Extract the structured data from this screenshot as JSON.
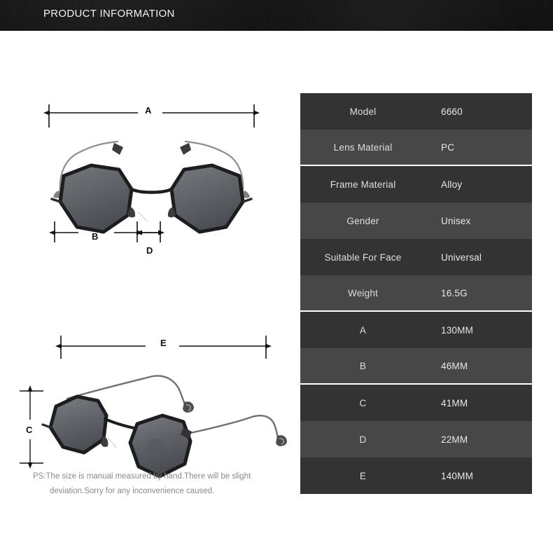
{
  "header": {
    "title": "PRODUCT INFORMATION"
  },
  "diagrams": {
    "front_view": {
      "name": "sunglasses-front-view",
      "dimension_labels": [
        "A",
        "B",
        "D"
      ]
    },
    "angled_view": {
      "name": "sunglasses-angled-view",
      "dimension_labels": [
        "E",
        "C"
      ]
    },
    "labels": {
      "a": "A",
      "b": "B",
      "c": "C",
      "d": "D",
      "e": "E"
    }
  },
  "spec_table": {
    "rows": [
      {
        "label": "Model",
        "value": "6660"
      },
      {
        "label": "Lens Material",
        "value": "PC"
      },
      {
        "label": "Frame Material",
        "value": "Alloy"
      },
      {
        "label": "Gender",
        "value": "Unisex"
      },
      {
        "label": "Suitable For Face",
        "value": "Universal"
      },
      {
        "label": "Weight",
        "value": "16.5G"
      },
      {
        "label": "A",
        "value": "130MM"
      },
      {
        "label": "B",
        "value": "46MM"
      },
      {
        "label": "C",
        "value": "41MM"
      },
      {
        "label": "D",
        "value": "22MM"
      },
      {
        "label": "E",
        "value": "140MM"
      }
    ]
  },
  "footnote": {
    "line1": "PS:The size is manual measured by hand.There will be slight",
    "line2": "deviation.Sorry for any inconvenience caused."
  },
  "colors": {
    "header_bg": "#050505",
    "row_dark": "#333333",
    "row_light": "#474747",
    "separator": "#ffffff",
    "lens": "#5e6166",
    "frame": "#1d1d1f",
    "footnote_text": "#8a8a8a"
  }
}
